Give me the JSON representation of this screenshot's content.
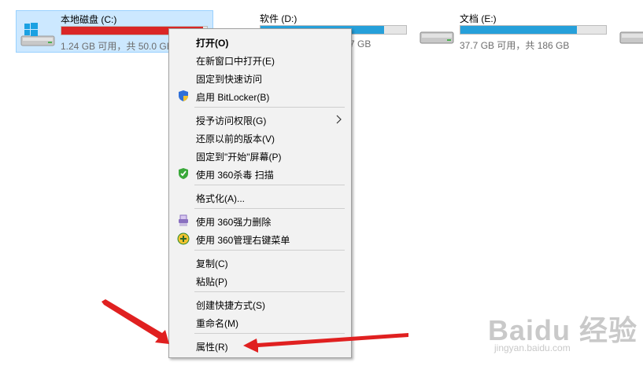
{
  "drives": [
    {
      "name": "本地磁盘 (C:)",
      "stats": "1.24 GB 可用，共 50.0 GB",
      "usage": 0.975,
      "fill_color": "#da2626",
      "selected": true,
      "icon": "windows-drive-icon"
    },
    {
      "name": "软件 (D:)",
      "stats": "7 GB",
      "usage": 0.85,
      "fill_color": "#26a0da",
      "selected": false,
      "icon": "drive-icon"
    },
    {
      "name": "文档 (E:)",
      "stats": "37.7 GB 可用，共 186 GB",
      "usage": 0.8,
      "fill_color": "#26a0da",
      "selected": false,
      "icon": "drive-icon"
    }
  ],
  "context_menu": {
    "open": "打开(O)",
    "open_new_window": "在新窗口中打开(E)",
    "pin_quick_access": "固定到快速访问",
    "bitlocker": "启用 BitLocker(B)",
    "grant_access": "授予访问权限(G)",
    "restore_versions": "还原以前的版本(V)",
    "pin_start": "固定到\"开始\"屏幕(P)",
    "scan_360": "使用 360杀毒 扫描",
    "format": "格式化(A)...",
    "shred_360": "使用 360强力删除",
    "manage_360": "使用 360管理右键菜单",
    "copy": "复制(C)",
    "paste": "粘贴(P)",
    "create_shortcut": "创建快捷方式(S)",
    "rename": "重命名(M)",
    "properties": "属性(R)"
  },
  "watermark": {
    "logo": "Baidu 经验",
    "url": "jingyan.baidu.com"
  },
  "colors": {
    "annotation_arrow": "#e02020",
    "selection_bg": "#cce8ff"
  }
}
